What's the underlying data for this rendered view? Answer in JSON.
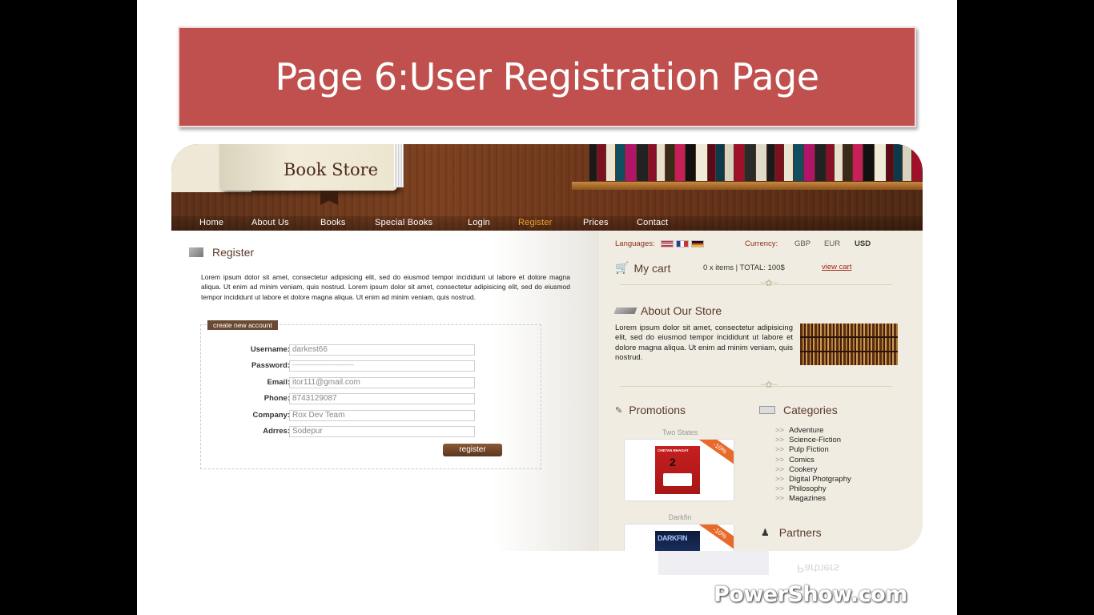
{
  "slide": {
    "title": "Page 6:User Registration Page",
    "watermark": "PowerShow.com"
  },
  "site": {
    "logo_text": "Book Store",
    "nav": [
      "Home",
      "About Us",
      "Books",
      "Special Books",
      "Login",
      "Register",
      "Prices",
      "Contact"
    ],
    "nav_active": "Register",
    "register": {
      "heading": "Register",
      "intro": "Lorem ipsum dolor sit amet, consectetur adipisicing elit, sed do eiusmod tempor incididunt ut labore et dolore magna aliqua. Ut enim ad minim veniam, quis nostrud. Lorem ipsum dolor sit amet, consectetur adipisicing elit, sed do eiusmod tempor incididunt ut labore et dolore magna aliqua. Ut enim ad minim veniam, quis nostrud.",
      "legend": "create new account",
      "fields": [
        {
          "label": "Username:",
          "value": "darkest66"
        },
        {
          "label": "Password:",
          "value": "---------------------------------"
        },
        {
          "label": "Email:",
          "value": "itor111@gmail.com"
        },
        {
          "label": "Phone:",
          "value": "8743129087"
        },
        {
          "label": "Company:",
          "value": "Rox Dev Team"
        },
        {
          "label": "Adrres:",
          "value": "Sodepur"
        }
      ],
      "submit_label": "register"
    },
    "sidebar": {
      "languages_label": "Languages:",
      "currency_label": "Currency:",
      "currencies": [
        "GBP",
        "EUR",
        "USD"
      ],
      "cart_title": "My cart",
      "cart_info": "0 x items | TOTAL: 100$",
      "view_cart": "view cart",
      "about_title": "About Our Store",
      "about_text": "Lorem ipsum dolor sit amet, consectetur adipisicing elit, sed do eiusmod tempor incididunt ut labore et dolore magna aliqua. Ut enim ad minim veniam, quis nostrud.",
      "promotions_title": "Promotions",
      "promotions": [
        {
          "name": "Two States",
          "badge": "-10%",
          "cover_text": "CHETAN BHAGAT"
        },
        {
          "name": "Darkfin",
          "badge": "-10%",
          "cover_text": "DARKFIN"
        }
      ],
      "categories_title": "Categories",
      "categories": [
        "Adventure",
        "Science-Fiction",
        "Pulp Fiction",
        "Comics",
        "Cookery",
        "Digital Photgraphy",
        "Philosophy",
        "Magazines"
      ],
      "category_bullet": ">>",
      "partners_title": "Partners"
    }
  },
  "colors": {
    "title_banner": "#c0504d",
    "nav_active": "#f0a030",
    "heading_brown": "#5a3a2a",
    "link_red": "#a02b1a"
  }
}
